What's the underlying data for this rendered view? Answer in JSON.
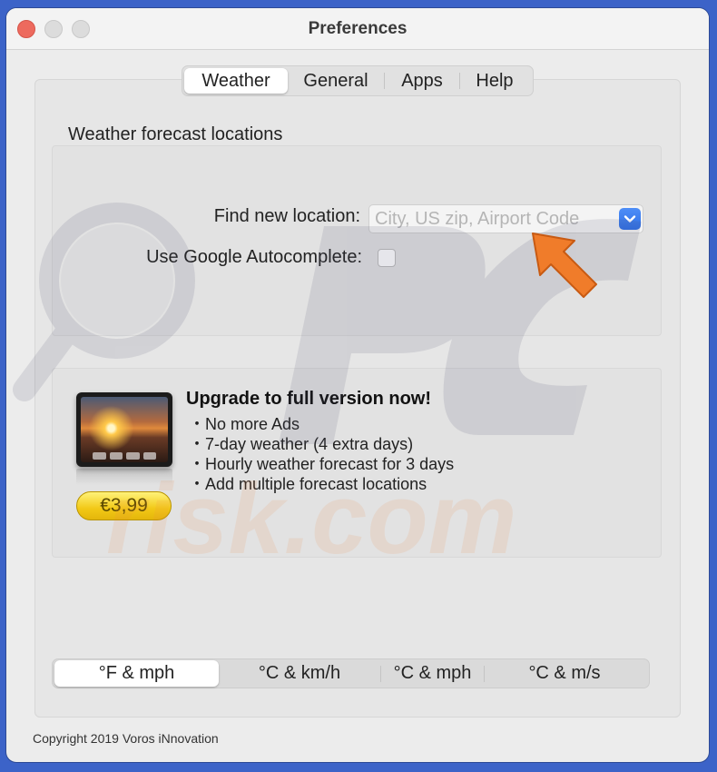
{
  "window": {
    "title": "Preferences"
  },
  "tabs": [
    {
      "label": "Weather",
      "selected": true
    },
    {
      "label": "General",
      "selected": false
    },
    {
      "label": "Apps",
      "selected": false
    },
    {
      "label": "Help",
      "selected": false
    }
  ],
  "locations": {
    "section_label": "Weather forecast locations",
    "find_label": "Find new location:",
    "find_placeholder": "City, US zip, Airport Code",
    "find_value": "",
    "google_label": "Use Google Autocomplete:",
    "google_checked": false
  },
  "upgrade": {
    "title": "Upgrade to full version now!",
    "features": [
      "・No more Ads",
      "・7-day weather (4 extra days)",
      "・Hourly weather forecast for 3 days",
      "・Add multiple forecast locations"
    ],
    "price": "€3,99"
  },
  "units": [
    {
      "label": "°F & mph",
      "selected": true
    },
    {
      "label": "°C & km/h",
      "selected": false
    },
    {
      "label": "°C & mph",
      "selected": false
    },
    {
      "label": "°C & m/s",
      "selected": false
    }
  ],
  "footer": {
    "copyright": "Copyright 2019 Voros iNnovation"
  },
  "watermark": {
    "text": "risk.com"
  },
  "colors": {
    "accent_blue": "#2f6fe6",
    "price_yellow": "#f2c916",
    "close_red": "#ed6a5e",
    "arrow_orange": "#f07c2a",
    "desktop": "#3c63c8"
  },
  "icons": {
    "combo": "chevron-down-icon",
    "annotation": "arrow-icon",
    "watermark": "magnifier-icon"
  }
}
